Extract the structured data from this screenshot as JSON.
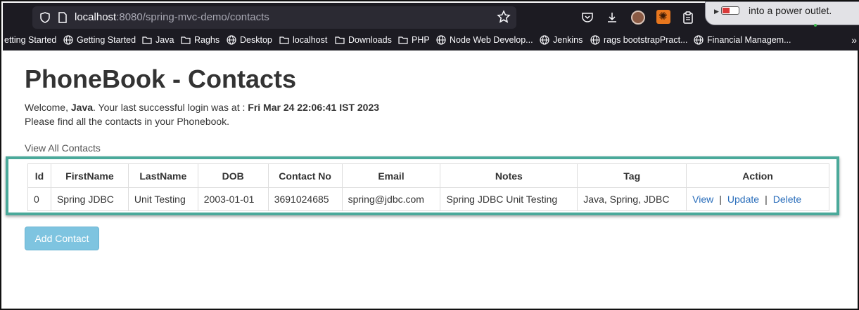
{
  "browser": {
    "url_host": "localhost",
    "url_rest": ":8080/spring-mvc-demo/contacts",
    "notification_text": "into a power outlet.",
    "bookmarks": [
      {
        "label": "etting Started",
        "icon": "none"
      },
      {
        "label": "Getting Started",
        "icon": "globe-icon"
      },
      {
        "label": "Java",
        "icon": "folder-icon"
      },
      {
        "label": "Raghs",
        "icon": "folder-icon"
      },
      {
        "label": "Desktop",
        "icon": "globe-icon"
      },
      {
        "label": "localhost",
        "icon": "folder-icon"
      },
      {
        "label": "Downloads",
        "icon": "folder-icon"
      },
      {
        "label": "PHP",
        "icon": "folder-icon"
      },
      {
        "label": "Node Web Develop...",
        "icon": "globe-icon"
      },
      {
        "label": "Jenkins",
        "icon": "globe-icon"
      },
      {
        "label": "rags bootstrapPract...",
        "icon": "globe-icon"
      },
      {
        "label": "Financial Managem...",
        "icon": "globe-icon"
      }
    ],
    "overflow_label": "»"
  },
  "page": {
    "title": "PhoneBook - Contacts",
    "welcome_prefix": "Welcome, ",
    "user": "Java",
    "welcome_middle": ". Your last successful login was at : ",
    "last_login": "Fri Mar 24 22:06:41 IST 2023",
    "subline": "Please find all the contacts in your Phonebook.",
    "view_all": "View All Contacts",
    "add_contact": "Add Contact"
  },
  "table": {
    "headers": [
      "Id",
      "FirstName",
      "LastName",
      "DOB",
      "Contact No",
      "Email",
      "Notes",
      "Tag",
      "Action"
    ],
    "rows": [
      {
        "id": "0",
        "first_name": "Spring JDBC",
        "last_name": "Unit Testing",
        "dob": "2003-01-01",
        "contact_no": "3691024685",
        "email": "spring@jdbc.com",
        "notes": "Spring JDBC Unit Testing",
        "tag": "Java, Spring, JDBC",
        "actions": {
          "view": "View",
          "update": "Update",
          "delete": "Delete",
          "separator": "|"
        }
      }
    ]
  },
  "colors": {
    "highlight_border": "#4aa99a",
    "link": "#2a6ebb",
    "button_bg": "#7ec4e0",
    "chrome_bg": "#1c1b22"
  }
}
